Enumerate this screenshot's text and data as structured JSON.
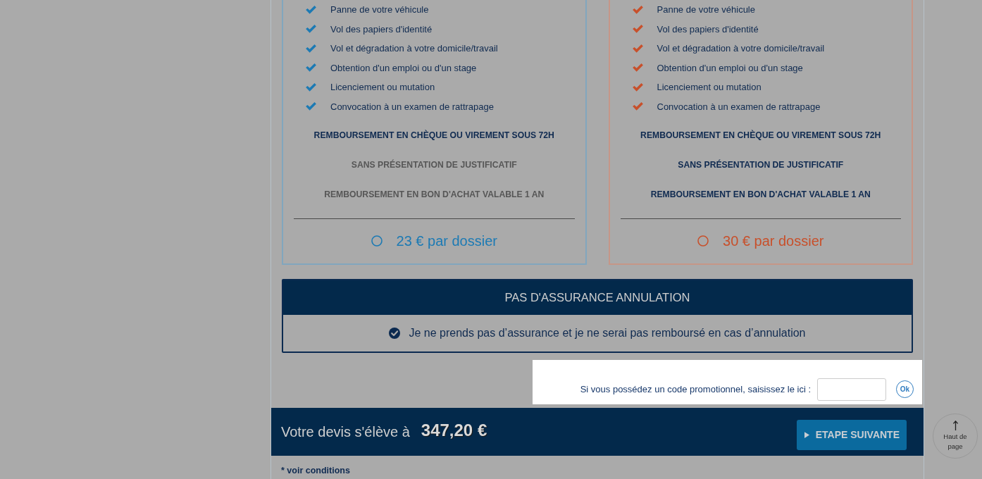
{
  "plans": [
    {
      "color": "#1c7ab4",
      "selected": false,
      "features": [
        "Panne de votre véhicule",
        "Vol des papiers d'identité",
        "Vol et dégradation à votre domicile/travail",
        "Obtention d'un emploi ou d'un stage",
        "Licenciement ou mutation",
        "Convocation à un examen de rattrapage"
      ],
      "guarantees": [
        {
          "text": "REMBOURSEMENT EN CHÈQUE OU VIREMENT SOUS 72H",
          "included": true
        },
        {
          "text": "SANS PRÉSENTATION DE JUSTIFICATIF",
          "included": false
        },
        {
          "text": "REMBOURSEMENT EN BON D'ACHAT VALABLE 1 AN",
          "included": false
        }
      ],
      "price": "23 € par dossier"
    },
    {
      "color": "#c8502b",
      "selected": false,
      "features": [
        "Panne de votre véhicule",
        "Vol des papiers d'identité",
        "Vol et dégradation à votre domicile/travail",
        "Obtention d'un emploi ou d'un stage",
        "Licenciement ou mutation",
        "Convocation à un examen de rattrapage"
      ],
      "guarantees": [
        {
          "text": "REMBOURSEMENT EN CHÈQUE OU VIREMENT SOUS 72H",
          "included": true
        },
        {
          "text": "SANS PRÉSENTATION DE JUSTIFICATIF",
          "included": true
        },
        {
          "text": "REMBOURSEMENT EN BON D'ACHAT VALABLE 1 AN",
          "included": true
        }
      ],
      "price": "30 € par dossier"
    }
  ],
  "no_insurance": {
    "title": "PAS D'ASSURANCE ANNULATION",
    "label": "Je ne prends pas d’assurance et je ne serai pas remboursé en cas d’annulation",
    "selected": true
  },
  "promo": {
    "label": "Si vous possédez un code promotionnel, saisissez le ici :",
    "button": "Ok"
  },
  "quote_bar": {
    "label": "Votre devis s'élève à",
    "amount": "347,20 €",
    "next_button": "ETAPE SUIVANTE"
  },
  "footnote": "* voir conditions",
  "back_to_top": {
    "label": "Haut de page"
  }
}
